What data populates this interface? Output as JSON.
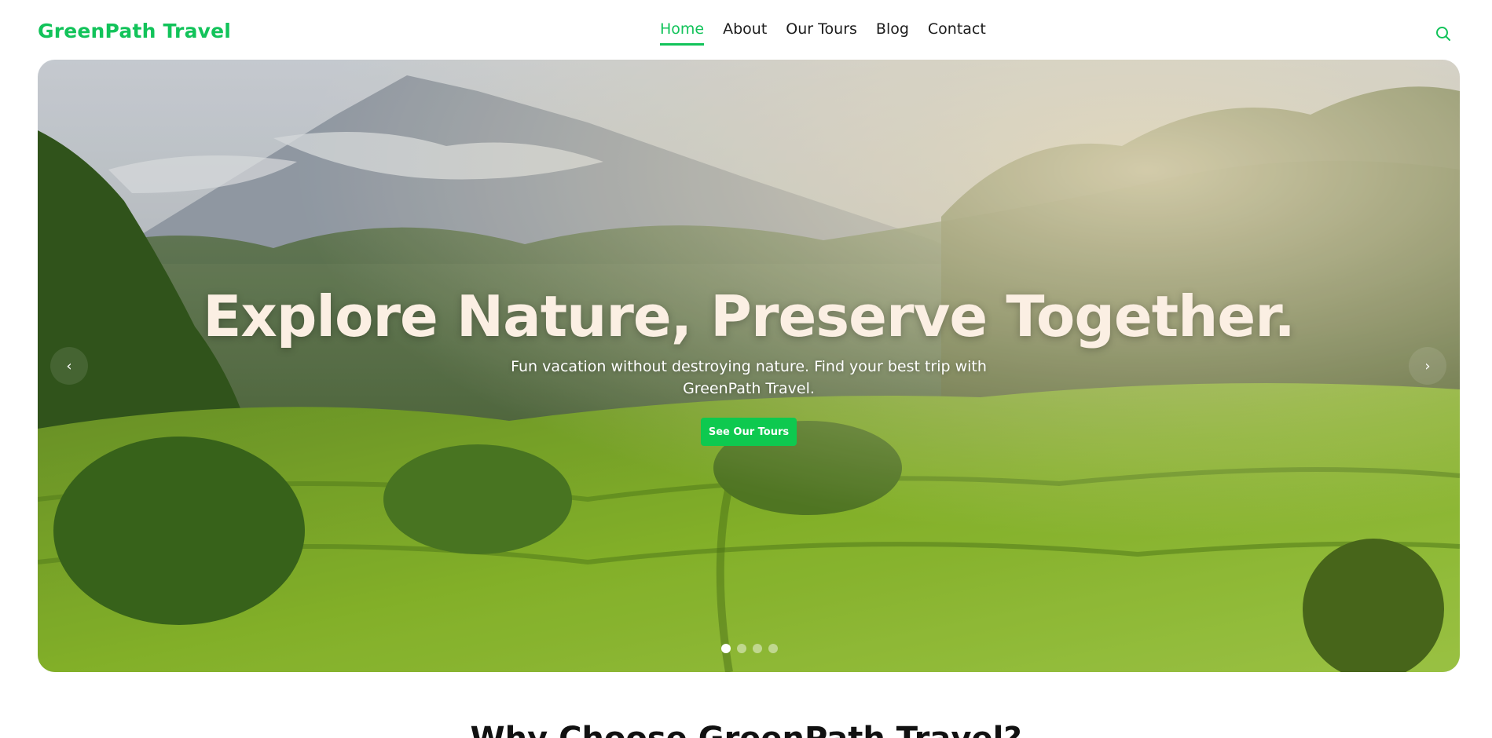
{
  "navbar": {
    "brand": "GreenPath Travel",
    "links": [
      {
        "label": "Home",
        "active": true
      },
      {
        "label": "About",
        "active": false
      },
      {
        "label": "Our Tours",
        "active": false
      },
      {
        "label": "Blog",
        "active": false
      },
      {
        "label": "Contact",
        "active": false
      }
    ],
    "search_icon": "search-icon"
  },
  "hero": {
    "title": "Explore Nature, Preserve Together.",
    "subtitle": "Fun vacation without destroying nature. Find your best trip with GreenPath Travel.",
    "cta_label": "See Our Tours",
    "prev_glyph": "‹",
    "next_glyph": "›",
    "slides_count": 4,
    "active_slide": 1
  },
  "section": {
    "title": "Why Choose GreenPath Travel?"
  },
  "colors": {
    "brand": "#12c35a",
    "cta": "#0ec94f",
    "hero_title": "#fbefe3"
  }
}
